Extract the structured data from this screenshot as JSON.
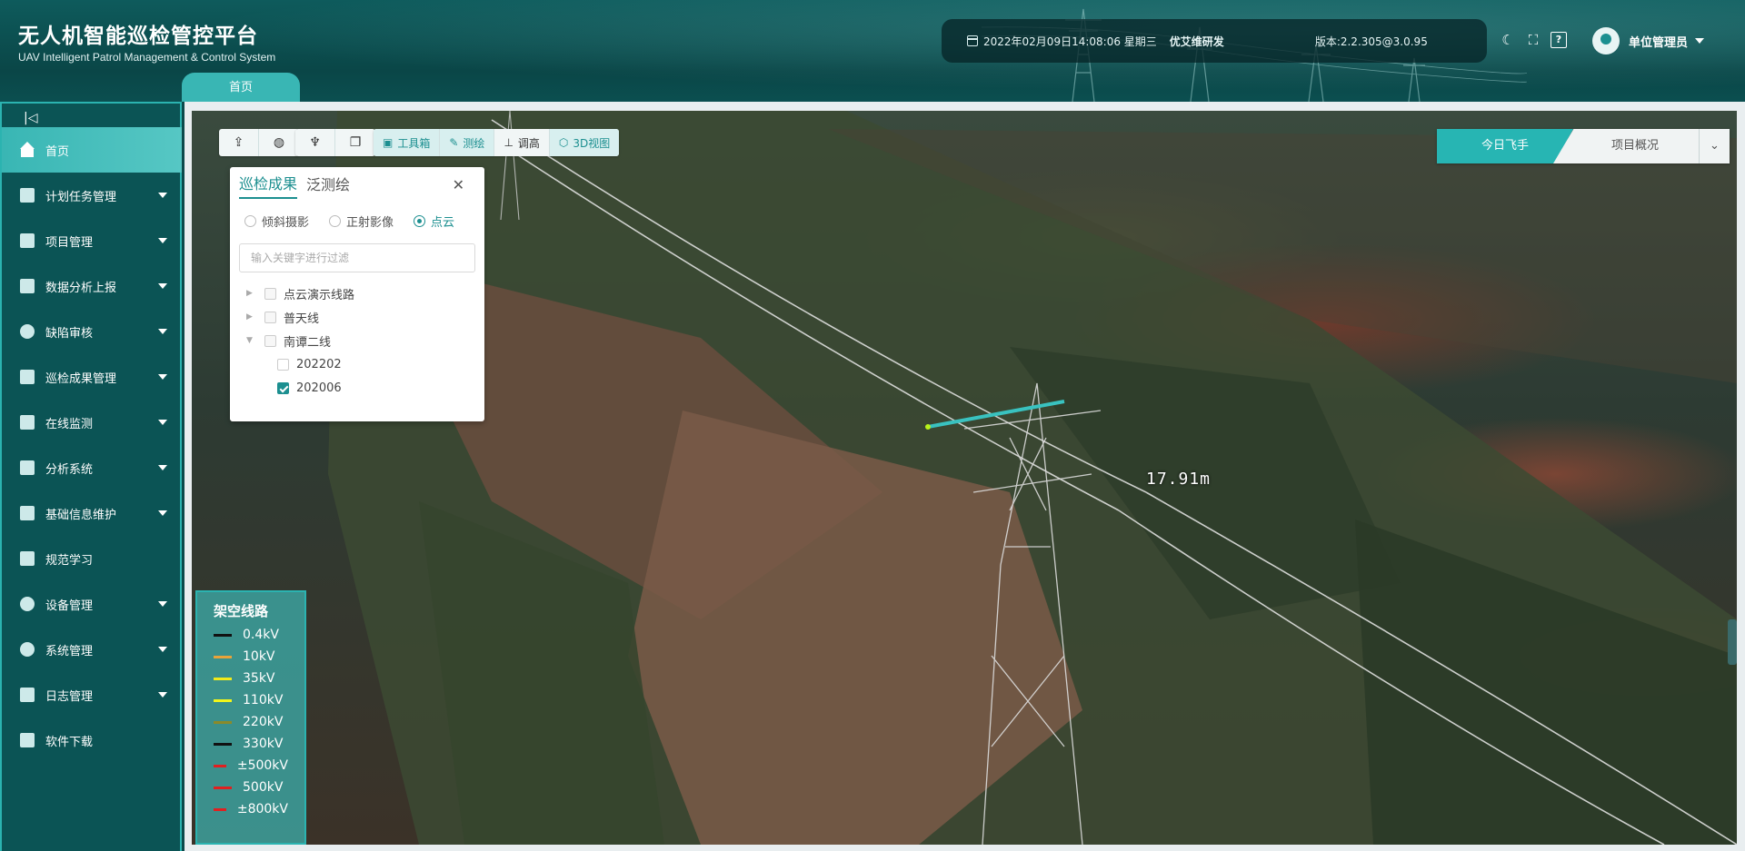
{
  "header": {
    "title_cn": "无人机智能巡检管控平台",
    "title_en": "UAV Intelligent Patrol Management & Control System",
    "datetime": "2022年02月09日14:08:06 星期三",
    "company": "优艾维研发",
    "version": "版本:2.2.305@3.0.95",
    "user_name": "单位管理员",
    "home_tab": "首页"
  },
  "sidebar": {
    "items": [
      {
        "label": "首页",
        "icon": "home-icon"
      },
      {
        "label": "计划任务管理",
        "icon": "task-icon"
      },
      {
        "label": "项目管理",
        "icon": "project-icon"
      },
      {
        "label": "数据分析上报",
        "icon": "report-icon"
      },
      {
        "label": "缺陷审核",
        "icon": "user-icon"
      },
      {
        "label": "巡检成果管理",
        "icon": "folder-icon"
      },
      {
        "label": "在线监测",
        "icon": "monitor-icon"
      },
      {
        "label": "分析系统",
        "icon": "chart-icon"
      },
      {
        "label": "基础信息维护",
        "icon": "layers-icon"
      },
      {
        "label": "规范学习",
        "icon": "book-icon"
      },
      {
        "label": "设备管理",
        "icon": "drone-icon"
      },
      {
        "label": "系统管理",
        "icon": "settings-user-icon"
      },
      {
        "label": "日志管理",
        "icon": "log-icon"
      },
      {
        "label": "软件下载",
        "icon": "download-icon"
      }
    ]
  },
  "toolbar": {
    "toolbox": "工具箱",
    "measure": "测绘",
    "height": "调高",
    "view3d": "3D视图"
  },
  "right_tabs": {
    "today": "今日飞手",
    "overview": "项目概况"
  },
  "panel": {
    "tab_results": "巡检成果",
    "tab_survey": "泛测绘",
    "radio_oblique": "倾斜摄影",
    "radio_ortho": "正射影像",
    "radio_pointcloud": "点云",
    "filter_placeholder": "输入关键字进行过滤",
    "tree": [
      {
        "label": "点云演示线路"
      },
      {
        "label": "普天线"
      },
      {
        "label": "南谭二线"
      },
      {
        "label": "202202"
      },
      {
        "label": "202006"
      }
    ]
  },
  "measurement": "17.91m",
  "legend": {
    "title": "架空线路",
    "items": [
      {
        "label": "0.4kV",
        "color": "#111111"
      },
      {
        "label": "10kV",
        "color": "#e8a33a"
      },
      {
        "label": "35kV",
        "color": "#f2ea1a"
      },
      {
        "label": "110kV",
        "color": "#f2f51a"
      },
      {
        "label": "220kV",
        "color": "#8a8a2a"
      },
      {
        "label": "330kV",
        "color": "#111111"
      },
      {
        "label": "±500kV",
        "color": "#e02020"
      },
      {
        "label": "500kV",
        "color": "#e02020"
      },
      {
        "label": "±800kV",
        "color": "#e02020"
      }
    ]
  }
}
